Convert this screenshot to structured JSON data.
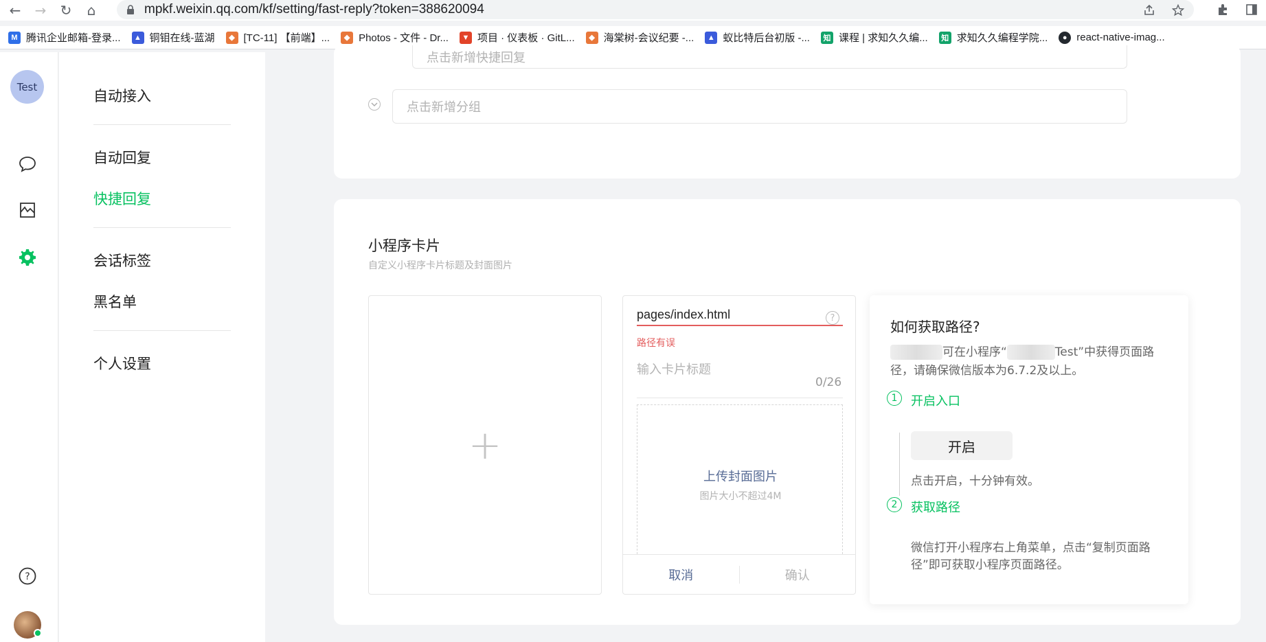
{
  "browser": {
    "url": "mpkf.weixin.qq.com/kf/setting/fast-reply?token=388620094",
    "bookmarks": [
      {
        "label": "腾讯企业邮箱-登录...",
        "color": "#2f6fe8",
        "icon": "mail-icon"
      },
      {
        "label": "铜钼在线-蓝湖",
        "color": "#3b5bdb",
        "icon": "bookmark-icon"
      },
      {
        "label": "[TC-11] 【前端】...",
        "color": "#e8773a",
        "icon": "bookmark-icon"
      },
      {
        "label": "Photos - 文件 - Dr...",
        "color": "#e8773a",
        "icon": "bookmark-icon"
      },
      {
        "label": "项目 · 仪表板 · GitL...",
        "color": "#e24329",
        "icon": "gitlab-icon"
      },
      {
        "label": "海棠树-会议纪要 -...",
        "color": "#e8773a",
        "icon": "bookmark-icon"
      },
      {
        "label": "蚁比特后台初版 -...",
        "color": "#3b5bdb",
        "icon": "bookmark-icon"
      },
      {
        "label": "课程 | 求知久久编...",
        "color": "#13a36a",
        "icon": "zhi-icon"
      },
      {
        "label": "求知久久编程学院...",
        "color": "#13a36a",
        "icon": "zhi-icon"
      },
      {
        "label": "react-native-imag...",
        "color": "#24292f",
        "icon": "github-icon"
      }
    ]
  },
  "rail": {
    "avatar_label": "Test"
  },
  "submenu": {
    "auto_accept": "自动接入",
    "auto_reply": "自动回复",
    "quick_reply": "快捷回复",
    "session_tags": "会话标签",
    "blacklist": "黑名单",
    "personal_settings": "个人设置"
  },
  "top_card": {
    "quick_reply_placeholder": "点击新增快捷回复",
    "group_placeholder": "点击新增分组"
  },
  "mini_card": {
    "title": "小程序卡片",
    "subtitle": "自定义小程序卡片标题及封面图片",
    "path_value": "pages/index.html",
    "path_help": "?",
    "path_error": "路径有误",
    "card_title_placeholder": "输入卡片标题",
    "char_count": "0/26",
    "cover_upload_label": "上传封面图片",
    "cover_upload_hint": "图片大小不超过4M",
    "cancel_label": "取消",
    "confirm_label": "确认"
  },
  "guide": {
    "title": "如何获取路径?",
    "desc_mid": "可在小程序“",
    "desc_end": "Test”中获得页面路径，请确保微信版本为6.7.2及以上。",
    "step1_num": "1",
    "step1_label": "开启入口",
    "open_button": "开启",
    "open_desc": "点击开启，十分钟有效。",
    "step2_num": "2",
    "step2_label": "获取路径",
    "step2_desc": "微信打开小程序右上角菜单，点击“复制页面路径”即可获取小程序页面路径。"
  },
  "colors": {
    "accent": "#07c160",
    "error": "#e35c5c",
    "link": "#576b95"
  }
}
